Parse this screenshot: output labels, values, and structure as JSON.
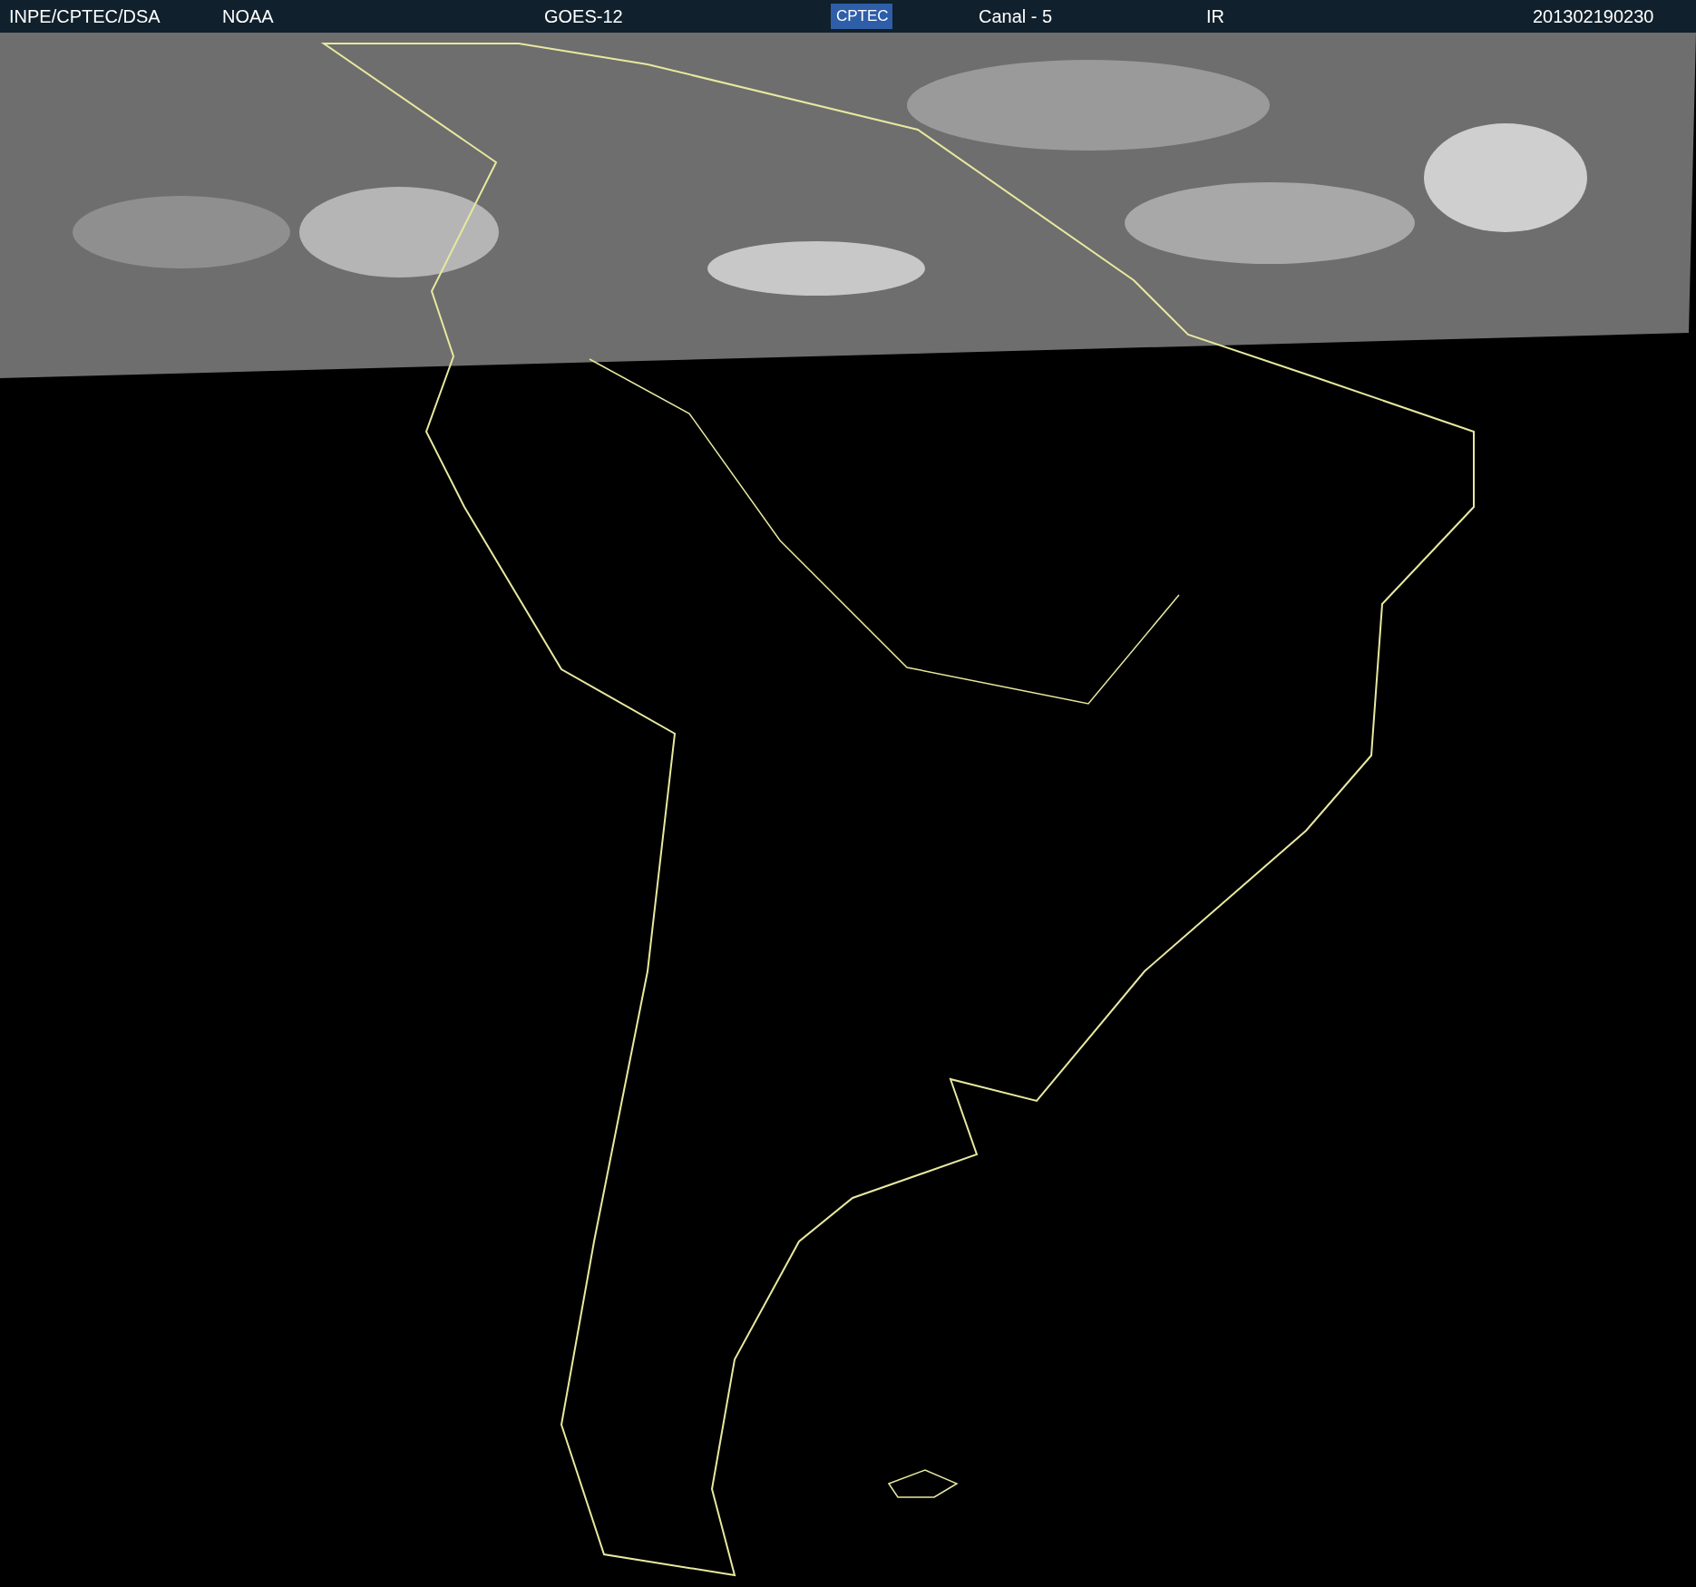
{
  "header": {
    "items": [
      {
        "text": "INPE/CPTEC/DSA"
      },
      {
        "text": "NOAA"
      },
      {
        "text": "GOES-12"
      }
    ],
    "logo": {
      "text": "CPTEC"
    },
    "items_right": [
      {
        "text": "Canal - 5"
      },
      {
        "text": "IR"
      },
      {
        "text": "201302190230"
      }
    ]
  }
}
